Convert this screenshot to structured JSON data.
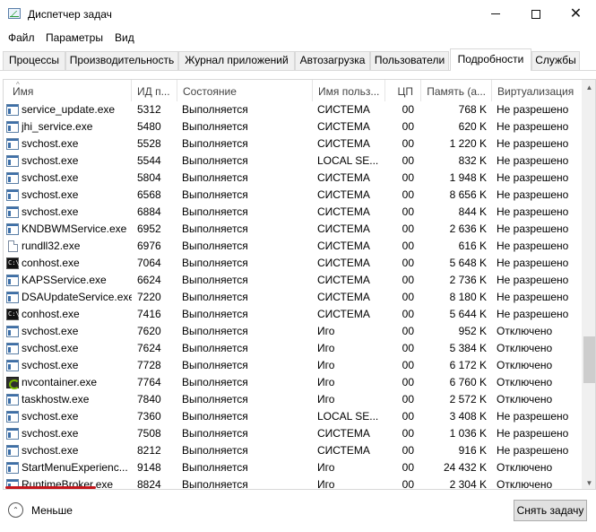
{
  "window": {
    "title": "Диспетчер задач",
    "minimize_glyph": "—",
    "close_glyph": "✕"
  },
  "menu": [
    "Файл",
    "Параметры",
    "Вид"
  ],
  "tabs": [
    {
      "label": "Процессы",
      "active": false
    },
    {
      "label": "Производительность",
      "active": false
    },
    {
      "label": "Журнал приложений",
      "active": false
    },
    {
      "label": "Автозагрузка",
      "active": false
    },
    {
      "label": "Пользователи",
      "active": false
    },
    {
      "label": "Подробности",
      "active": true
    },
    {
      "label": "Службы",
      "active": false
    }
  ],
  "table": {
    "columns": [
      "Имя",
      "ИД п...",
      "Состояние",
      "Имя польз...",
      "ЦП",
      "Память (а...",
      "Виртуализация"
    ],
    "sort_indicator": "^",
    "rows": [
      {
        "icon": "service-icon",
        "name": "service_update.exe",
        "pid": "5312",
        "state": "Выполняется",
        "user": "СИСТЕМА",
        "cpu": "00",
        "mem": "768 K",
        "virt": "Не разрешено"
      },
      {
        "icon": "service-icon",
        "name": "jhi_service.exe",
        "pid": "5480",
        "state": "Выполняется",
        "user": "СИСТЕМА",
        "cpu": "00",
        "mem": "620 K",
        "virt": "Не разрешено"
      },
      {
        "icon": "service-icon",
        "name": "svchost.exe",
        "pid": "5528",
        "state": "Выполняется",
        "user": "СИСТЕМА",
        "cpu": "00",
        "mem": "1 220 K",
        "virt": "Не разрешено"
      },
      {
        "icon": "service-icon",
        "name": "svchost.exe",
        "pid": "5544",
        "state": "Выполняется",
        "user": "LOCAL SE...",
        "cpu": "00",
        "mem": "832 K",
        "virt": "Не разрешено"
      },
      {
        "icon": "service-icon",
        "name": "svchost.exe",
        "pid": "5804",
        "state": "Выполняется",
        "user": "СИСТЕМА",
        "cpu": "00",
        "mem": "1 948 K",
        "virt": "Не разрешено"
      },
      {
        "icon": "service-icon",
        "name": "svchost.exe",
        "pid": "6568",
        "state": "Выполняется",
        "user": "СИСТЕМА",
        "cpu": "00",
        "mem": "8 656 K",
        "virt": "Не разрешено"
      },
      {
        "icon": "service-icon",
        "name": "svchost.exe",
        "pid": "6884",
        "state": "Выполняется",
        "user": "СИСТЕМА",
        "cpu": "00",
        "mem": "844 K",
        "virt": "Не разрешено"
      },
      {
        "icon": "service-icon",
        "name": "KNDBWMService.exe",
        "pid": "6952",
        "state": "Выполняется",
        "user": "СИСТЕМА",
        "cpu": "00",
        "mem": "2 636 K",
        "virt": "Не разрешено"
      },
      {
        "icon": "document-icon",
        "name": "rundll32.exe",
        "pid": "6976",
        "state": "Выполняется",
        "user": "СИСТЕМА",
        "cpu": "00",
        "mem": "616 K",
        "virt": "Не разрешено"
      },
      {
        "icon": "console-icon",
        "name": "conhost.exe",
        "pid": "7064",
        "state": "Выполняется",
        "user": "СИСТЕМА",
        "cpu": "00",
        "mem": "5 648 K",
        "virt": "Не разрешено"
      },
      {
        "icon": "service-icon",
        "name": "KAPSService.exe",
        "pid": "6624",
        "state": "Выполняется",
        "user": "СИСТЕМА",
        "cpu": "00",
        "mem": "2 736 K",
        "virt": "Не разрешено"
      },
      {
        "icon": "service-icon",
        "name": "DSAUpdateService.exe",
        "pid": "7220",
        "state": "Выполняется",
        "user": "СИСТЕМА",
        "cpu": "00",
        "mem": "8 180 K",
        "virt": "Не разрешено"
      },
      {
        "icon": "console-icon",
        "name": "conhost.exe",
        "pid": "7416",
        "state": "Выполняется",
        "user": "СИСТЕМА",
        "cpu": "00",
        "mem": "5 644 K",
        "virt": "Не разрешено"
      },
      {
        "icon": "service-icon",
        "name": "svchost.exe",
        "pid": "7620",
        "state": "Выполняется",
        "user": "Иго",
        "cpu": "00",
        "mem": "952 K",
        "virt": "Отключено"
      },
      {
        "icon": "service-icon",
        "name": "svchost.exe",
        "pid": "7624",
        "state": "Выполняется",
        "user": "Иго",
        "cpu": "00",
        "mem": "5 384 K",
        "virt": "Отключено"
      },
      {
        "icon": "service-icon",
        "name": "svchost.exe",
        "pid": "7728",
        "state": "Выполняется",
        "user": "Иго",
        "cpu": "00",
        "mem": "6 172 K",
        "virt": "Отключено"
      },
      {
        "icon": "nvidia-icon",
        "name": "nvcontainer.exe",
        "pid": "7764",
        "state": "Выполняется",
        "user": "Иго",
        "cpu": "00",
        "mem": "6 760 K",
        "virt": "Отключено"
      },
      {
        "icon": "service-icon",
        "name": "taskhostw.exe",
        "pid": "7840",
        "state": "Выполняется",
        "user": "Иго",
        "cpu": "00",
        "mem": "2 572 K",
        "virt": "Отключено"
      },
      {
        "icon": "service-icon",
        "name": "svchost.exe",
        "pid": "7360",
        "state": "Выполняется",
        "user": "LOCAL SE...",
        "cpu": "00",
        "mem": "3 408 K",
        "virt": "Не разрешено"
      },
      {
        "icon": "service-icon",
        "name": "svchost.exe",
        "pid": "7508",
        "state": "Выполняется",
        "user": "СИСТЕМА",
        "cpu": "00",
        "mem": "1 036 K",
        "virt": "Не разрешено"
      },
      {
        "icon": "service-icon",
        "name": "svchost.exe",
        "pid": "8212",
        "state": "Выполняется",
        "user": "СИСТЕМА",
        "cpu": "00",
        "mem": "916 K",
        "virt": "Не разрешено"
      },
      {
        "icon": "service-icon",
        "name": "StartMenuExperienc...",
        "pid": "9148",
        "state": "Выполняется",
        "user": "Иго",
        "cpu": "00",
        "mem": "24 432 K",
        "virt": "Отключено"
      },
      {
        "icon": "service-icon",
        "name": "RuntimeBroker.exe",
        "pid": "8824",
        "state": "Выполняется",
        "user": "Иго",
        "cpu": "00",
        "mem": "2 304 K",
        "virt": "Отключено"
      }
    ]
  },
  "footer": {
    "less_label": "Меньше",
    "end_task_label": "Снять задачу"
  },
  "colors": {
    "highlight_underline": "#c4161c"
  }
}
